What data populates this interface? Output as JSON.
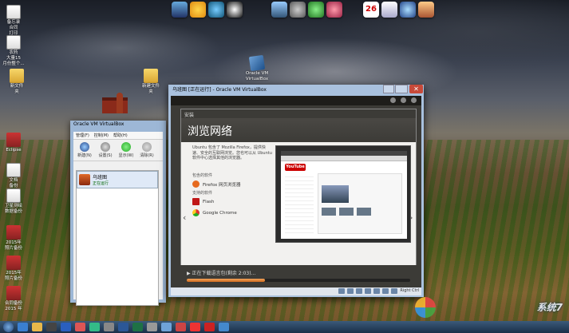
{
  "desktop": {
    "icons": [
      {
        "label": "备忘录\n合同\n打印",
        "kind": "doc"
      },
      {
        "label": "农药\n大量15\n月份整个...",
        "kind": "doc"
      },
      {
        "label": "新文件\n夹",
        "kind": "folder"
      },
      {
        "label": "新建文件\n夹",
        "kind": "folder"
      },
      {
        "label": "Oracle VM\nVirtualBox",
        "kind": "vbox"
      },
      {
        "label": "Eclipse",
        "kind": "exe"
      },
      {
        "label": "文档\n备份",
        "kind": "doc"
      },
      {
        "label": "卫星测绘\n数据备份",
        "kind": "doc"
      },
      {
        "label": "2015年\n照片备份",
        "kind": "exe"
      },
      {
        "label": "2015年\n照片备份",
        "kind": "exe"
      },
      {
        "label": "合同备份\n2015 年",
        "kind": "exe"
      }
    ],
    "dock_icons": [
      "monitor-icon",
      "weather-icon",
      "ie-icon",
      "qq-icon",
      "network-icon",
      "gear-icon",
      "chat-icon",
      "media-icon",
      "calendar-icon",
      "notes-icon",
      "globe-icon",
      "photo-icon"
    ],
    "calendar_day": "26"
  },
  "manager": {
    "title": "Oracle VM VirtualBox",
    "menu": [
      "管理(F)",
      "控制(M)",
      "帮助(H)"
    ],
    "tools": [
      "新建(N)",
      "设置(S)",
      "显示(W)",
      "清除(R)"
    ],
    "vm": {
      "name": "乌班图",
      "state": "正在运行"
    }
  },
  "vmwindow": {
    "title": "乌班图 [正在运行] - Oracle VM VirtualBox",
    "close": "✕",
    "installer": {
      "section": "安装",
      "heading": "浏览网络",
      "description": "Ubuntu 包含了 Mozilla Firefox，提供快速、安全的互联网浏览。您也可以从 Ubuntu 软件中心选择其他的浏览器。",
      "included_label": "包含的软件",
      "included": [
        {
          "name": "Firefox 网页浏览器",
          "icon": "firefox-icon",
          "color": "#e66a1f"
        }
      ],
      "supported_label": "支持的软件",
      "supported": [
        {
          "name": "Flash",
          "icon": "flash-icon",
          "color": "#c01818"
        },
        {
          "name": "Google Chrome",
          "icon": "chrome-icon",
          "color": "#3a8ee6"
        }
      ],
      "youtube": "YouTube",
      "progress_text": "▶ 正在下载语言包(剩余 2:03)...",
      "progress": 0.35
    },
    "status_label": "Right Ctrl"
  },
  "watermark": "系统7"
}
